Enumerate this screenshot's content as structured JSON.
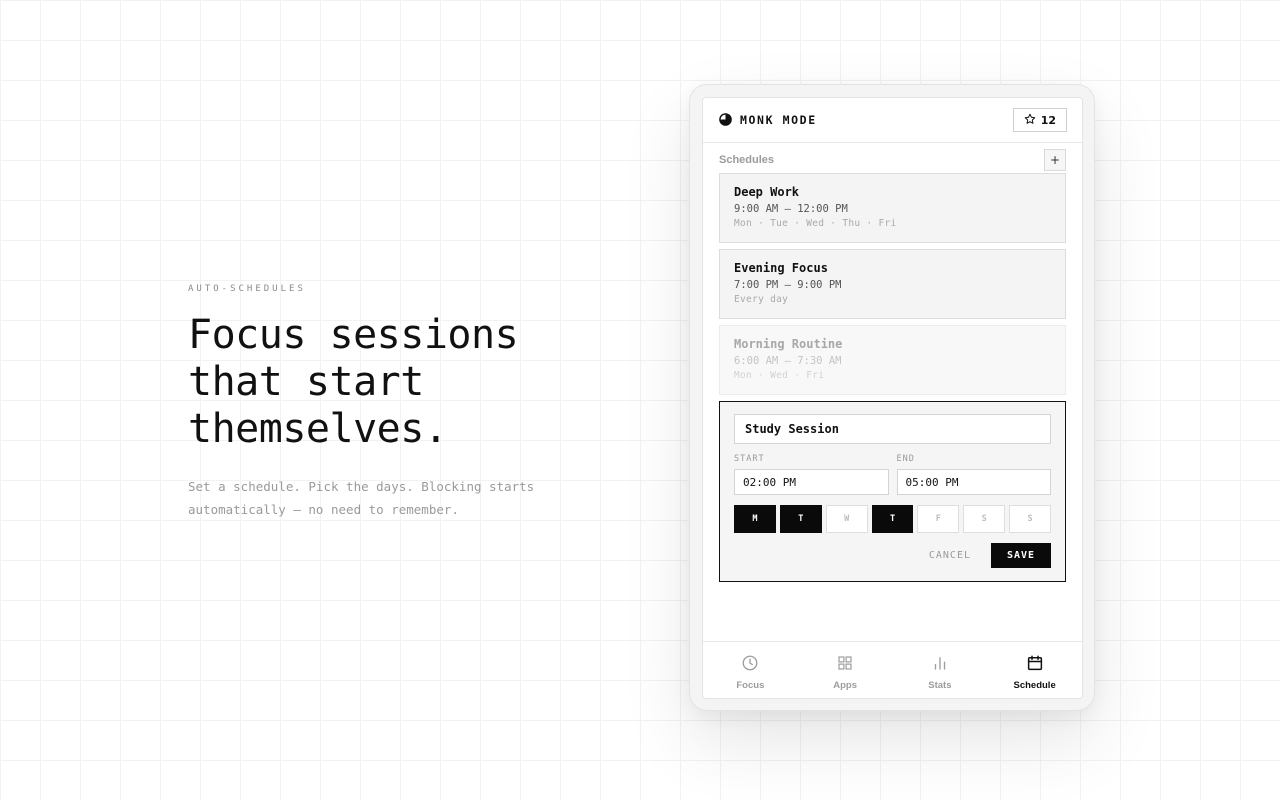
{
  "hero": {
    "eyebrow": "AUTO-SCHEDULES",
    "headline": [
      "Focus sessions",
      "that start",
      "themselves."
    ],
    "subtitle": [
      "Set a schedule. Pick the days. Blocking starts",
      "automatically — no need to remember."
    ]
  },
  "app": {
    "brand": "MONK MODE",
    "star_count": "12",
    "section_title": "Schedules",
    "add_label": "+",
    "schedules": [
      {
        "name": "Deep Work",
        "time": "9:00 AM – 12:00 PM",
        "days": "Mon · Tue · Wed · Thu · Fri",
        "enabled": true
      },
      {
        "name": "Evening Focus",
        "time": "7:00 PM – 9:00 PM",
        "days": "Every day",
        "enabled": true
      },
      {
        "name": "Morning Routine",
        "time": "6:00 AM – 7:30 AM",
        "days": "Mon · Wed · Fri",
        "enabled": false
      }
    ],
    "editor": {
      "name_value": "Study Session",
      "start_label": "START",
      "end_label": "END",
      "start_value": "02:00 PM",
      "end_value": "05:00 PM",
      "days": [
        {
          "label": "M",
          "on": true
        },
        {
          "label": "T",
          "on": true
        },
        {
          "label": "W",
          "on": false
        },
        {
          "label": "T",
          "on": true
        },
        {
          "label": "F",
          "on": false
        },
        {
          "label": "S",
          "on": false
        },
        {
          "label": "S",
          "on": false
        }
      ],
      "cancel_label": "CANCEL",
      "save_label": "SAVE"
    },
    "tabs": [
      {
        "label": "Focus",
        "icon": "clock-icon",
        "active": false
      },
      {
        "label": "Apps",
        "icon": "grid-icon",
        "active": false
      },
      {
        "label": "Stats",
        "icon": "bar-chart-icon",
        "active": false
      },
      {
        "label": "Schedule",
        "icon": "calendar-icon",
        "active": true
      }
    ]
  }
}
